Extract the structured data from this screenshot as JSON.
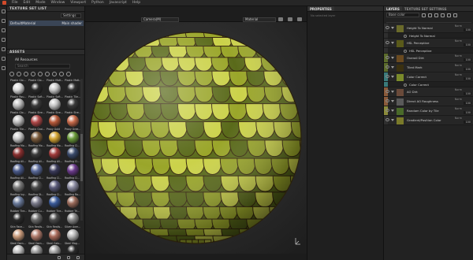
{
  "menu": [
    "File",
    "Edit",
    "Mode",
    "Window",
    "Viewport",
    "Python",
    "Javascript",
    "Help"
  ],
  "texture_set_list": {
    "title": "TEXTURE SET LIST",
    "settings_label": "Settings",
    "rows": [
      {
        "name": "DefaultMaterial",
        "shader": "Main shader"
      }
    ]
  },
  "assets": {
    "title": "ASSETS",
    "breadcrumb": "All Resources",
    "search_placeholder": "Search",
    "items": [
      {
        "label": "Plastic Glo...",
        "color": "#d8d8d8"
      },
      {
        "label": "Plastic Glo...",
        "color": "#2a2a2a"
      },
      {
        "label": "Plastic Matt...",
        "color": "#c8c8c8"
      },
      {
        "label": "Plastic Matt...",
        "color": "#303030"
      },
      {
        "label": "Plastic Rou...",
        "color": "#bdbdbd"
      },
      {
        "label": "Plastic Soft...",
        "color": "#3a3a3a"
      },
      {
        "label": "Plastic Soft...",
        "color": "#c4c4c4"
      },
      {
        "label": "Plastic Tile...",
        "color": "#3a3a3a"
      },
      {
        "label": "Plastic Glo...",
        "color": "#bcbcbc"
      },
      {
        "label": "Plastic Stre...",
        "color": "#b04848"
      },
      {
        "label": "Plastic Stre...",
        "color": "#b85a3a"
      },
      {
        "label": "Plastic Stre...",
        "color": "#c86a4a"
      },
      {
        "label": "Plastic Tile...",
        "color": "#c8c8c8"
      },
      {
        "label": "Plastic Grai...",
        "color": "#7a5a3a"
      },
      {
        "label": "Proxy Gold",
        "color": "#d4a533"
      },
      {
        "label": "Proxy Gree...",
        "color": "#6a9a3a"
      },
      {
        "label": "Roofing Mo...",
        "color": "#8a3030"
      },
      {
        "label": "Roofing Mo...",
        "color": "#3a3a3a"
      },
      {
        "label": "Roofing Mo...",
        "color": "#a03a3a"
      },
      {
        "label": "Roofing Cl...",
        "color": "#3a4a6a"
      },
      {
        "label": "Roofing All...",
        "color": "#4a5a8a"
      },
      {
        "label": "Roofing All...",
        "color": "#5a6a9a"
      },
      {
        "label": "Roofing All...",
        "color": "#3a3a5a"
      },
      {
        "label": "Roofing Cl...",
        "color": "#6a3a8a"
      },
      {
        "label": "Roofing All...",
        "color": "#7a7a7a"
      },
      {
        "label": "Roofing Cl...",
        "color": "#4a4a4a"
      },
      {
        "label": "Roofing Cl...",
        "color": "#5a5a7a"
      },
      {
        "label": "Roofing Cl...",
        "color": "#8a8aa0"
      },
      {
        "label": "Roofing Ivy...",
        "color": "#6a7a9a"
      },
      {
        "label": "Roofing St...",
        "color": "#7a7a8a"
      },
      {
        "label": "Roofing Ci...",
        "color": "#3a5a9a"
      },
      {
        "label": "Roofing Ro...",
        "color": "#9a6a5a"
      },
      {
        "label": "Rubber Tire...",
        "color": "#2a2a2a"
      },
      {
        "label": "Rubber Cu...",
        "color": "#6a6a6a"
      },
      {
        "label": "Rubber Tire...",
        "color": "#4a4a4a"
      },
      {
        "label": "Rubber Tri...",
        "color": "#8a8a8a"
      },
      {
        "label": "Skin Face...",
        "color": "#c89a7a"
      },
      {
        "label": "Skin Realis...",
        "color": "#b07a6a"
      },
      {
        "label": "Skin Realis...",
        "color": "#a86a5a"
      },
      {
        "label": "Silver Aver...",
        "color": "#b8b8b8"
      },
      {
        "label": "Steel Dam...",
        "color": "#c0c0c0"
      },
      {
        "label": "Steel Dam...",
        "color": "#9a9a9a"
      },
      {
        "label": "Steel Galv...",
        "color": "#a0a0a0"
      },
      {
        "label": "Steel Mag...",
        "color": "#2a2a2a"
      }
    ]
  },
  "viewport": {
    "channel_dropdown": "Camera(M)",
    "mode_dropdown": "Material",
    "sphere_colors": {
      "base": "#9aa62a",
      "light": "#cbd24a",
      "dark": "#5a6a1a",
      "edge": "#3a2a10"
    }
  },
  "properties": {
    "title": "PROPERTIES",
    "hint": "No selected layer",
    "status_text": ""
  },
  "layers": {
    "tab_layers": "LAYERS",
    "tab_tss": "TEXTURE SET SETTINGS",
    "channel_dropdown": "Base color",
    "rows": [
      {
        "name": "Height To Normal",
        "type": "fill",
        "swatch": "#6a6a2a",
        "strip": "#2f2f2f",
        "blend": "Norm",
        "opacity": "100"
      },
      {
        "name": "Height To Normal",
        "type": "sub",
        "strip": "#2f2f2f"
      },
      {
        "name": "HSL Perceptive",
        "type": "fill",
        "swatch": "#5a5a1a",
        "strip": "#2f2f2f",
        "blend": "Norm",
        "opacity": "100"
      },
      {
        "name": "HSL Perceptive",
        "type": "sub",
        "strip": "#2f2f2f"
      },
      {
        "name": "Overall Dirt",
        "type": "fill",
        "swatch": "#6a4a20",
        "strip": "#5a6a2a",
        "blend": "Norm",
        "opacity": "100"
      },
      {
        "name": "Tiled Mark",
        "type": "fill",
        "swatch": "#3a3010",
        "strip": "#5a6a2a",
        "blend": "Norm",
        "opacity": "100"
      },
      {
        "name": "Color Correct",
        "type": "fill",
        "swatch": "#7a8a2a",
        "strip": "#3a7a7a",
        "blend": "Norm",
        "opacity": "100"
      },
      {
        "name": "Color Correct",
        "type": "sub",
        "strip": "#3a7a7a"
      },
      {
        "name": "AO Dirt",
        "type": "fill",
        "swatch": "#6a4a3a",
        "strip": "#8a5a3a",
        "blend": "Norm",
        "opacity": "100"
      },
      {
        "name": "Direct AO Roughness",
        "type": "fill",
        "swatch": "#5a5a5a",
        "strip": "#8a5a3a",
        "blend": "Norm",
        "opacity": "100"
      },
      {
        "name": "Random Color by Tile",
        "type": "fill",
        "swatch": "#4a6a2a",
        "strip": "#8a8a3a",
        "blend": "Norm",
        "opacity": "100"
      },
      {
        "name": "Gradient/Position Color",
        "type": "fill",
        "swatch": "#7a7a2a",
        "strip": "#2f2f2f",
        "blend": "Norm",
        "opacity": "100"
      }
    ]
  }
}
